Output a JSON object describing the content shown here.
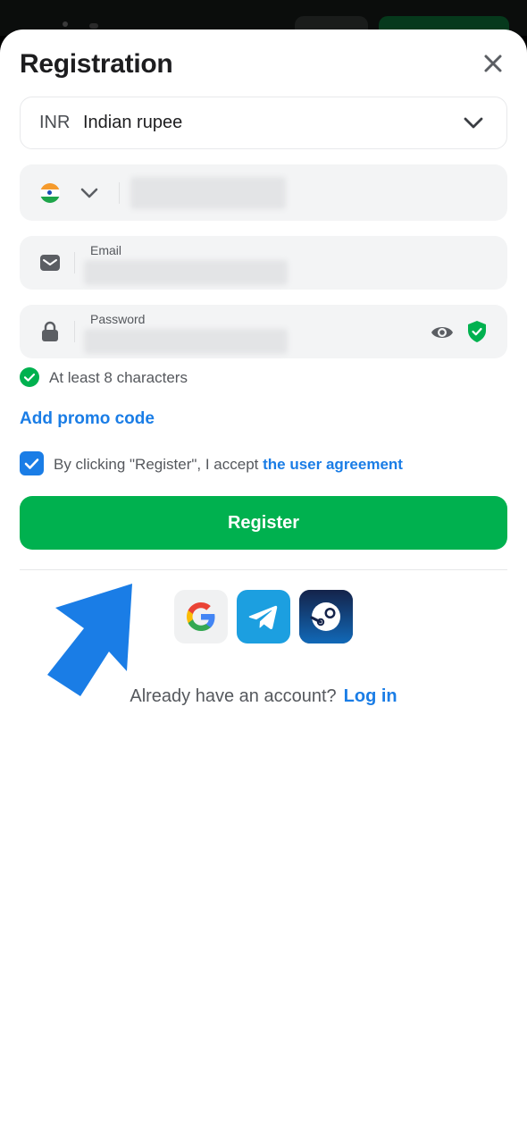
{
  "modal": {
    "title": "Registration",
    "close_icon": "close-icon"
  },
  "currency": {
    "code": "INR",
    "name": "Indian rupee",
    "icon": "chevron-down-icon"
  },
  "phone": {
    "country_icon": "india-flag-icon",
    "value": ""
  },
  "email": {
    "label": "Email",
    "value": "",
    "icon": "envelope-icon"
  },
  "password": {
    "label": "Password",
    "value": "",
    "icon": "lock-icon",
    "show_icon": "eye-icon",
    "strength_icon": "shield-check-icon"
  },
  "hint": {
    "text": "At least 8 characters",
    "icon": "check-circle-icon"
  },
  "promo": {
    "label": "Add promo code"
  },
  "agreement": {
    "checked": true,
    "prefix": "By clicking \"Register\", I accept",
    "link": "the user agreement"
  },
  "register_button": {
    "label": "Register"
  },
  "social": [
    {
      "name": "Google",
      "icon": "google-icon"
    },
    {
      "name": "Telegram",
      "icon": "telegram-icon"
    },
    {
      "name": "Steam",
      "icon": "steam-icon"
    }
  ],
  "footer": {
    "question": "Already have an account?",
    "login_link": "Log in"
  },
  "colors": {
    "accent_blue": "#1a7de6",
    "primary_green": "#00b14f",
    "field_bg": "#f3f4f5"
  }
}
